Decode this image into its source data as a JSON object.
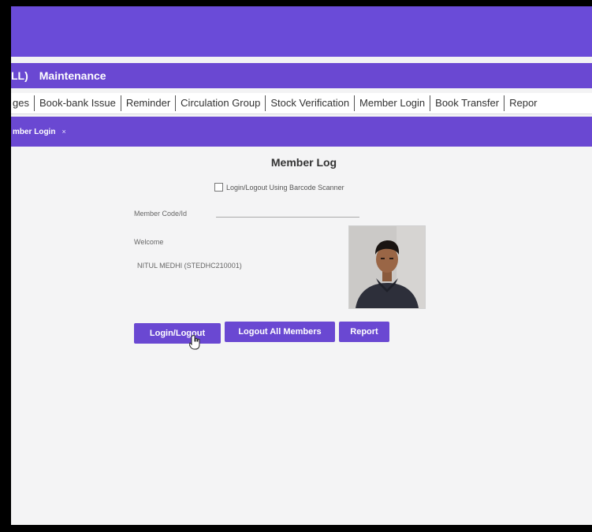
{
  "menubar": {
    "module": "LL)",
    "maintenance": "Maintenance"
  },
  "tabs": [
    {
      "label": "ges"
    },
    {
      "label": "Book-bank Issue"
    },
    {
      "label": "Reminder"
    },
    {
      "label": "Circulation Group"
    },
    {
      "label": "Stock Verification"
    },
    {
      "label": "Member Login"
    },
    {
      "label": "Book Transfer"
    },
    {
      "label": "Repor"
    }
  ],
  "doc_tab": {
    "label": "mber Login",
    "close": "×"
  },
  "page": {
    "title": "Member Log",
    "barcode_checkbox_label": "Login/Logout Using Barcode Scanner",
    "barcode_checked": false,
    "member_code_label": "Member Code/Id",
    "member_code_value": "",
    "welcome_label": "Welcome",
    "member_name": "NITUL MEDHI (STEDHC210001)"
  },
  "buttons": {
    "login_logout": "Login/Logout",
    "logout_all": "Logout All Members",
    "report": "Report"
  },
  "colors": {
    "accent": "#6a48d2",
    "banner": "#6a4bd8"
  }
}
